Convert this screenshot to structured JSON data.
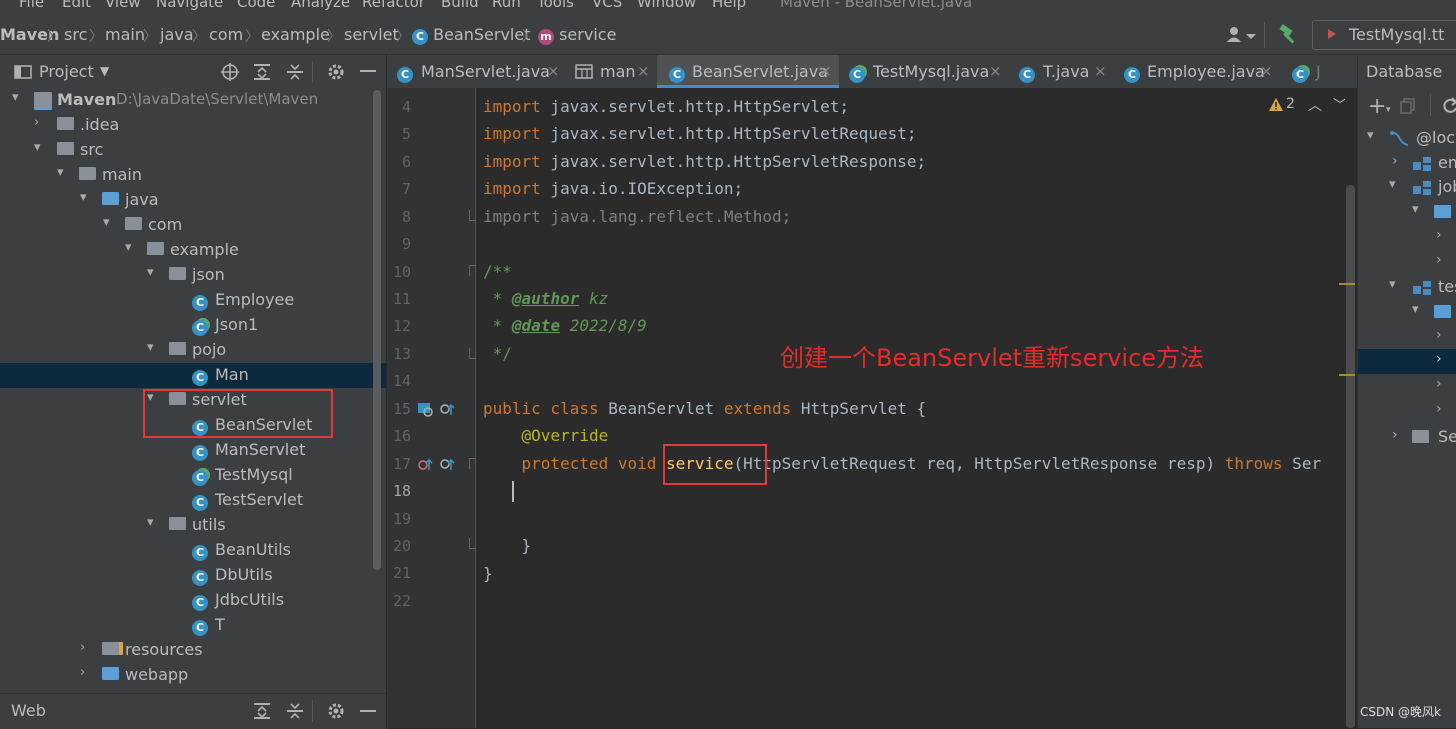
{
  "window_title": "Maven - BeanServlet.java",
  "menu": [
    "File",
    "Edit",
    "View",
    "Navigate",
    "Code",
    "Analyze",
    "Refactor",
    "Build",
    "Run",
    "Tools",
    "VCS",
    "Window",
    "Help"
  ],
  "breadcrumb": [
    "Maven",
    "src",
    "main",
    "java",
    "com",
    "example",
    "servlet",
    "BeanServlet",
    "service"
  ],
  "run_config": "TestMysql.tt",
  "project_panel": {
    "title": "Project",
    "root": {
      "name": "Maven",
      "path": "D:\\JavaDate\\Servlet\\Maven"
    },
    "nodes": [
      {
        "label": ".idea"
      },
      {
        "label": "src"
      },
      {
        "label": "main"
      },
      {
        "label": "java"
      },
      {
        "label": "com"
      },
      {
        "label": "example"
      },
      {
        "label": "json"
      },
      {
        "label": "Employee"
      },
      {
        "label": "Json1"
      },
      {
        "label": "pojo"
      },
      {
        "label": "Man"
      },
      {
        "label": "servlet"
      },
      {
        "label": "BeanServlet"
      },
      {
        "label": "ManServlet"
      },
      {
        "label": "TestMysql"
      },
      {
        "label": "TestServlet"
      },
      {
        "label": "utils"
      },
      {
        "label": "BeanUtils"
      },
      {
        "label": "DbUtils"
      },
      {
        "label": "JdbcUtils"
      },
      {
        "label": "T"
      },
      {
        "label": "resources"
      },
      {
        "label": "webapp"
      }
    ],
    "bottom_panel": "Web"
  },
  "tabs": [
    "ManServlet.java",
    "man",
    "BeanServlet.java",
    "TestMysql.java",
    "T.java",
    "Employee.java",
    "J"
  ],
  "active_tab": "BeanServlet.java",
  "inspection": {
    "warnings": "2"
  },
  "editor": {
    "line_numbers": [
      "4",
      "5",
      "6",
      "7",
      "8",
      "9",
      "10",
      "11",
      "12",
      "13",
      "14",
      "15",
      "16",
      "17",
      "18",
      "19",
      "20",
      "21",
      "22"
    ],
    "current_line": "18",
    "code": {
      "l4_kw": "import",
      "l4_rest": " javax.servlet.http.HttpServlet;",
      "l5_kw": "import",
      "l5_rest": " javax.servlet.http.HttpServletRequest;",
      "l6_kw": "import",
      "l6_rest": " javax.servlet.http.HttpServletResponse;",
      "l7_kw": "import",
      "l7_rest": " java.io.IOException;",
      "l8": "import java.lang.reflect.Method;",
      "l10": "/**",
      "l11_pre": " * ",
      "l11_tag": "@author",
      "l11_val": " kz",
      "l12_pre": " * ",
      "l12_tag": "@date",
      "l12_val": " 2022/8/9",
      "l13": " */",
      "l15_kw1": "public class",
      "l15_mid": " BeanServlet ",
      "l15_kw2": "extends",
      "l15_rest": " HttpServlet {",
      "l16": "    @Override",
      "l17_kw": "    protected void ",
      "l17_meth": "service",
      "l17_rest": "(HttpServletRequest req, HttpServletResponse resp) ",
      "l17_kw2": "throws",
      "l17_tail": " Ser",
      "l20": "    }",
      "l21": "}"
    }
  },
  "annotation_note": "创建一个BeanServlet重新service方法",
  "database_panel": {
    "title": "Database",
    "items": [
      "@loca",
      "em",
      "job",
      "tes",
      "Se"
    ]
  },
  "watermark": "CSDN @晚风k",
  "colors": {
    "highlight_box": "#e5383b",
    "note_text": "#e52b2b",
    "selection": "#0d293e",
    "accent": "#4a88c7"
  }
}
